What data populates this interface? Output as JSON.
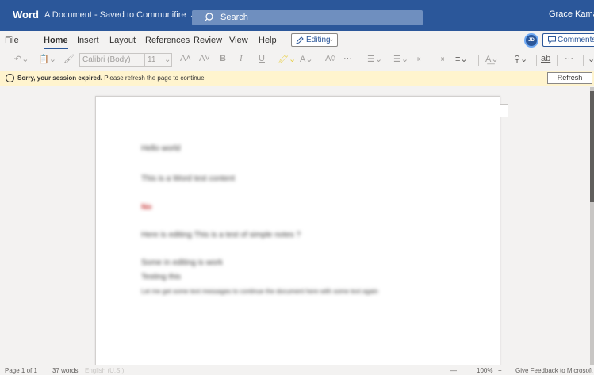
{
  "titlebar": {
    "app_name": "Word",
    "doc_title": "A Document - Saved to Communifire",
    "search_placeholder": "Search",
    "user_name": "Grace Kamau",
    "colors": {
      "brand": "#2b579a"
    }
  },
  "tabs": [
    "File",
    "Home",
    "Insert",
    "Layout",
    "References",
    "Review",
    "View",
    "Help"
  ],
  "active_tab": "Home",
  "editing_mode": "Editing",
  "avatar_initials": "JD",
  "comments_label": "Comments",
  "ribbon": {
    "font_name": "Calibri (Body)",
    "font_size": "11",
    "more": "···",
    "icons": [
      "undo-icon",
      "clipboard-icon",
      "format-painter-icon",
      "grow-font-icon",
      "shrink-font-icon",
      "bold-icon",
      "italic-icon",
      "underline-icon",
      "highlight-icon",
      "font-color-icon",
      "clear-format-icon",
      "bullets-icon",
      "numbering-icon",
      "decrease-indent-icon",
      "increase-indent-icon",
      "align-icon",
      "styles-icon",
      "find-icon",
      "dictate-icon"
    ]
  },
  "notification": {
    "title": "Sorry, your session expired.",
    "message": "Please refresh the page to continue.",
    "button": "Refresh"
  },
  "document": {
    "lines": [
      "Hello world",
      "This is a Word test content",
      "No",
      "Here is editing This is a test of simple notes ?",
      "Some in editing is work",
      "Testing this",
      "Let me get some text messages to continue the document here with some text again"
    ]
  },
  "status": {
    "page": "Page 1 of 1",
    "words": "37 words",
    "language": "English (U.S.)",
    "zoom_out": "—",
    "zoom": "100%",
    "zoom_in": "+",
    "feedback": "Give Feedback to Microsoft"
  }
}
